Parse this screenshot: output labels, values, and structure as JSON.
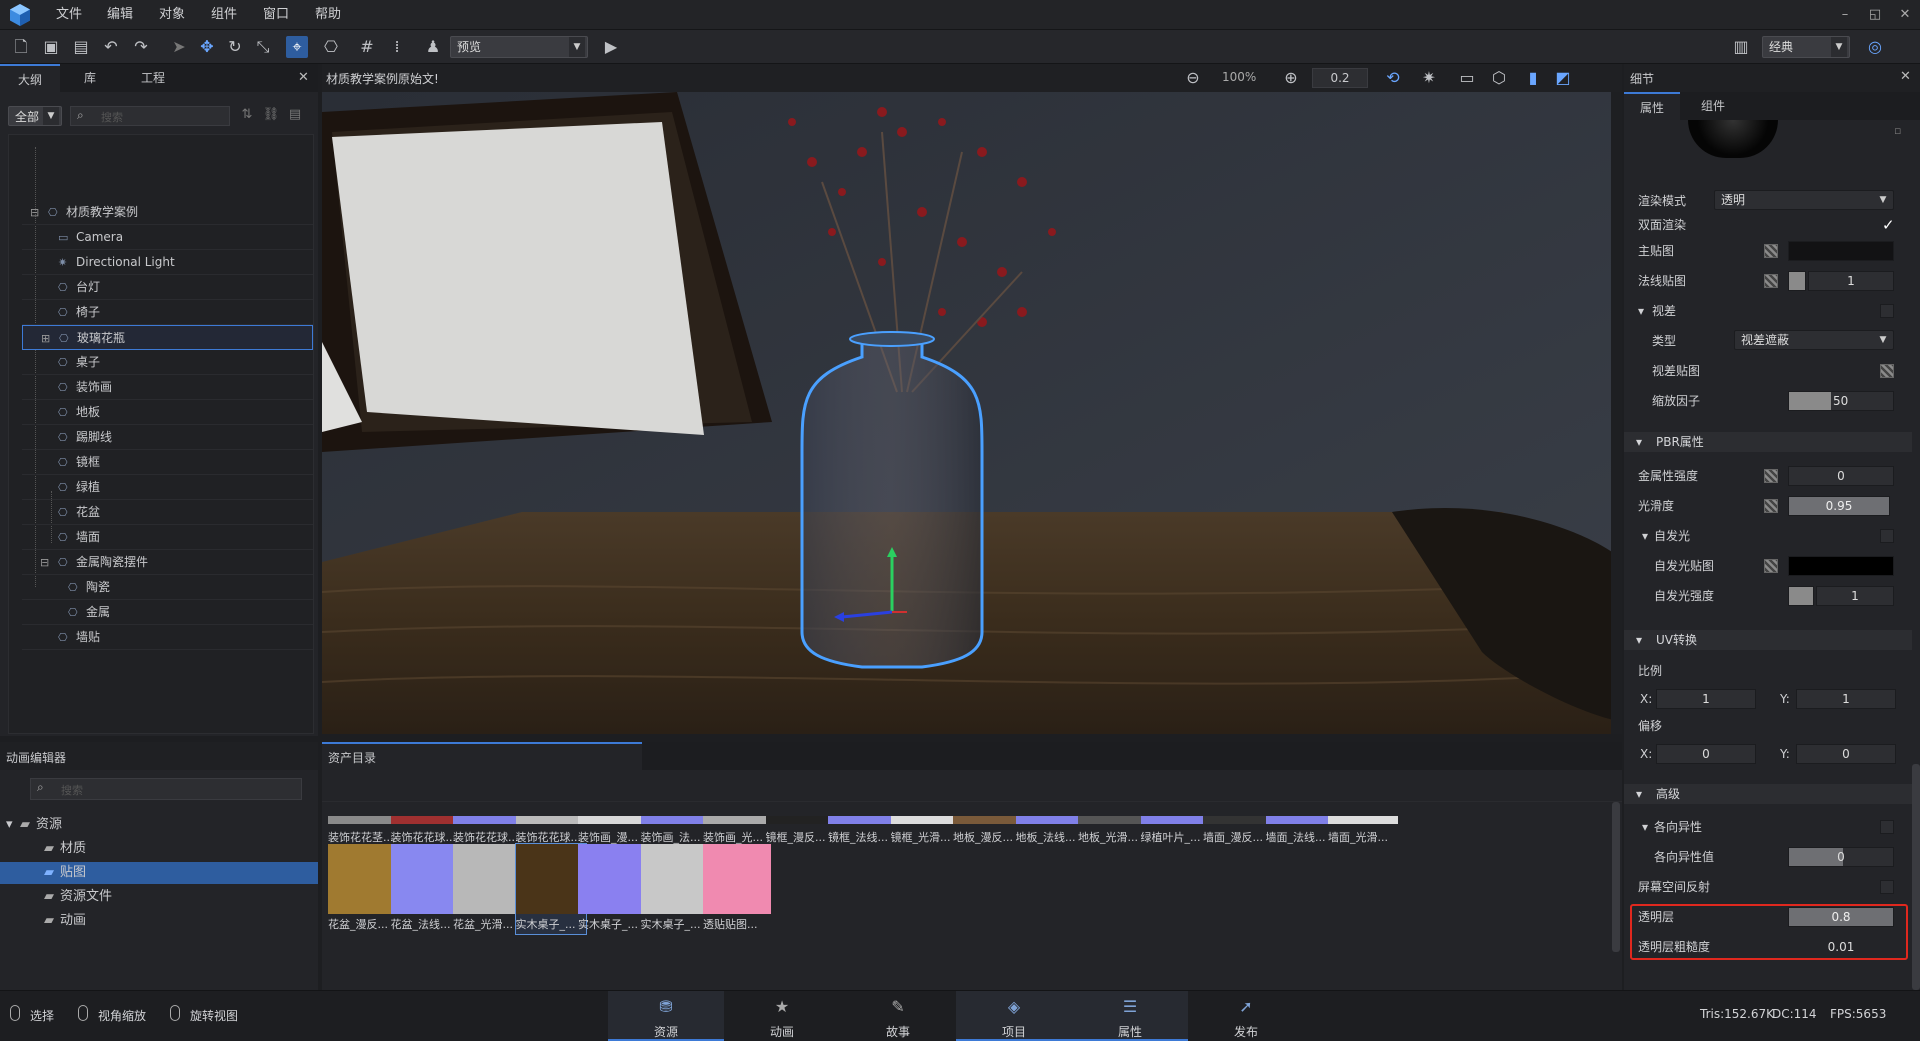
{
  "menubar": {
    "items": [
      "文件",
      "编辑",
      "对象",
      "组件",
      "窗口",
      "帮助"
    ],
    "window_controls": [
      "–",
      "◱",
      "✕"
    ]
  },
  "toolbar": {
    "mode_select": "预览",
    "layout_select": "经典"
  },
  "outline": {
    "tabs": [
      "大纲",
      "库",
      "工程"
    ],
    "filter_select": "全部",
    "search_placeholder": "搜索",
    "tree": [
      {
        "label": "材质教学案例",
        "icon": "object-icon"
      },
      {
        "label": "Camera",
        "icon": "camera-icon"
      },
      {
        "label": "Directional Light",
        "icon": "light-icon"
      },
      {
        "label": "台灯",
        "icon": "object-icon"
      },
      {
        "label": "椅子",
        "icon": "object-icon"
      },
      {
        "label": "玻璃花瓶",
        "icon": "object-icon"
      },
      {
        "label": "桌子",
        "icon": "object-icon"
      },
      {
        "label": "装饰画",
        "icon": "object-icon"
      },
      {
        "label": "地板",
        "icon": "object-icon"
      },
      {
        "label": "踢脚线",
        "icon": "object-icon"
      },
      {
        "label": "镜框",
        "icon": "object-icon"
      },
      {
        "label": "绿植",
        "icon": "object-icon"
      },
      {
        "label": "花盆",
        "icon": "object-icon"
      },
      {
        "label": "墙面",
        "icon": "object-icon"
      },
      {
        "label": "金属陶瓷摆件",
        "icon": "object-icon"
      },
      {
        "label": "陶瓷",
        "icon": "object-icon"
      },
      {
        "label": "金属",
        "icon": "object-icon"
      },
      {
        "label": "墙贴",
        "icon": "object-icon"
      }
    ]
  },
  "viewport": {
    "title": "材质教学案例原始文!",
    "zoom": "100%",
    "snap_value": "0.2"
  },
  "details": {
    "title": "细节",
    "tabs": [
      "属性",
      "组件"
    ],
    "render_mode_label": "渲染模式",
    "render_mode_value": "透明",
    "double_side_label": "双面渲染",
    "main_map_label": "主贴图",
    "normal_map_label": "法线贴图",
    "normal_map_value": "1",
    "parallax_label": "视差",
    "type_label": "类型",
    "type_value": "视差遮蔽",
    "parallax_map_label": "视差贴图",
    "scale_factor_label": "缩放因子",
    "scale_factor_value": "50",
    "pbr_section": "PBR属性",
    "metallic_label": "金属性强度",
    "metallic_value": "0",
    "smoothness_label": "光滑度",
    "smoothness_value": "0.95",
    "emission_label": "自发光",
    "emission_map_label": "自发光贴图",
    "emission_intensity_label": "自发光强度",
    "emission_intensity_value": "1",
    "uv_section": "UV转换",
    "scale_label": "比例",
    "scale_x_label": "X:",
    "scale_x": "1",
    "scale_y_label": "Y:",
    "scale_y": "1",
    "offset_label": "偏移",
    "offset_x_label": "X:",
    "offset_x": "0",
    "offset_y_label": "Y:",
    "offset_y": "0",
    "advanced_section": "高级",
    "anisotropy_label": "各向异性",
    "anisotropy_value_label": "各向异性值",
    "anisotropy_value": "0",
    "ssr_label": "屏幕空间反射",
    "clearcoat_label": "透明层",
    "clearcoat_value": "0.8",
    "clearcoat_roughness_label": "透明层粗糙度",
    "clearcoat_roughness_value": "0.01",
    "highlight_color": "#e0281e"
  },
  "anim_editor": {
    "title": "动画编辑器",
    "search_placeholder": "搜索",
    "tree": [
      {
        "label": "资源",
        "level": 0
      },
      {
        "label": "材质",
        "level": 1
      },
      {
        "label": "贴图",
        "level": 1,
        "selected": true
      },
      {
        "label": "资源文件",
        "level": 1
      },
      {
        "label": "动画",
        "level": 1
      }
    ]
  },
  "asset_dir": {
    "title": "资产目录",
    "row1": [
      {
        "name": "装饰花花茎...",
        "color": "#8a8a8a"
      },
      {
        "name": "装饰花花球...",
        "color": "#a03030"
      },
      {
        "name": "装饰花花球...",
        "color": "#8080e8"
      },
      {
        "name": "装饰花花球...",
        "color": "#bbbbbb"
      },
      {
        "name": "装饰画_漫...",
        "color": "#d8d8d8"
      },
      {
        "name": "装饰画_法...",
        "color": "#8080e8"
      },
      {
        "name": "装饰画_光...",
        "color": "#aaaaaa"
      },
      {
        "name": "镜框_漫反...",
        "color": "#222222"
      },
      {
        "name": "镜框_法线...",
        "color": "#8080e8"
      },
      {
        "name": "镜框_光滑...",
        "color": "#dddddd"
      },
      {
        "name": "地板_漫反...",
        "color": "#7a5a3a"
      },
      {
        "name": "地板_法线...",
        "color": "#8080e8"
      },
      {
        "name": "地板_光滑...",
        "color": "#555555"
      },
      {
        "name": "绿植叶片_...",
        "color": "#8080e8"
      },
      {
        "name": "墙面_漫反...",
        "color": "#333333"
      },
      {
        "name": "墙面_法线...",
        "color": "#8080e8"
      },
      {
        "name": "墙面_光滑...",
        "color": "#dddddd"
      }
    ],
    "row2": [
      {
        "name": "花盆_漫反...",
        "color": "#a07a30"
      },
      {
        "name": "花盆_法线...",
        "color": "#8888f0"
      },
      {
        "name": "花盆_光滑...",
        "color": "#b8b8b8"
      },
      {
        "name": "实木桌子_...",
        "color": "#4a3418",
        "selected": true
      },
      {
        "name": "实木桌子_...",
        "color": "#8a80f0"
      },
      {
        "name": "实木桌子_...",
        "color": "#c8c8c8"
      },
      {
        "name": "透贴贴图...",
        "color": "#f08ab0"
      }
    ]
  },
  "bottom_tabs": [
    {
      "label": "资源",
      "icon": "resource-icon"
    },
    {
      "label": "动画",
      "icon": "animation-icon"
    },
    {
      "label": "故事",
      "icon": "story-icon"
    },
    {
      "label": "项目",
      "icon": "project-icon"
    },
    {
      "label": "属性",
      "icon": "properties-icon"
    },
    {
      "label": "发布",
      "icon": "publish-icon"
    }
  ],
  "status": {
    "select": "选择",
    "zoom_view": "视角缩放",
    "rotate_view": "旋转视图",
    "tris": "Tris:152.67K",
    "dc": "DC:114",
    "fps": "FPS:5653"
  }
}
